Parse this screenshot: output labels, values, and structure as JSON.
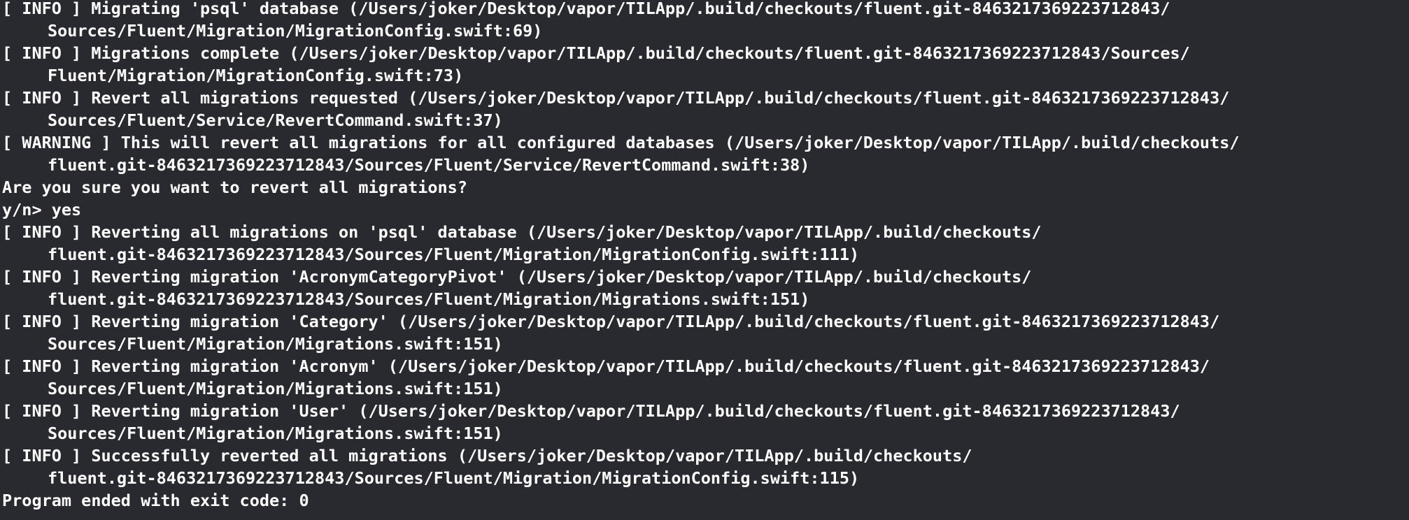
{
  "console": {
    "lines": [
      {
        "text": "[ INFO ] Migrating 'psql' database (/Users/joker/Desktop/vapor/TILApp/.build/checkouts/fluent.git-8463217369223712843/",
        "indent": false
      },
      {
        "text": "Sources/Fluent/Migration/MigrationConfig.swift:69)",
        "indent": true
      },
      {
        "text": "[ INFO ] Migrations complete (/Users/joker/Desktop/vapor/TILApp/.build/checkouts/fluent.git-8463217369223712843/Sources/",
        "indent": false
      },
      {
        "text": "Fluent/Migration/MigrationConfig.swift:73)",
        "indent": true
      },
      {
        "text": "[ INFO ] Revert all migrations requested (/Users/joker/Desktop/vapor/TILApp/.build/checkouts/fluent.git-8463217369223712843/",
        "indent": false
      },
      {
        "text": "Sources/Fluent/Service/RevertCommand.swift:37)",
        "indent": true
      },
      {
        "text": "[ WARNING ] This will revert all migrations for all configured databases (/Users/joker/Desktop/vapor/TILApp/.build/checkouts/",
        "indent": false
      },
      {
        "text": "fluent.git-8463217369223712843/Sources/Fluent/Service/RevertCommand.swift:38)",
        "indent": true
      },
      {
        "text": "Are you sure you want to revert all migrations?",
        "indent": false
      },
      {
        "text": "y/n> yes",
        "indent": false
      },
      {
        "text": "[ INFO ] Reverting all migrations on 'psql' database (/Users/joker/Desktop/vapor/TILApp/.build/checkouts/",
        "indent": false
      },
      {
        "text": "fluent.git-8463217369223712843/Sources/Fluent/Migration/MigrationConfig.swift:111)",
        "indent": true
      },
      {
        "text": "[ INFO ] Reverting migration 'AcronymCategoryPivot' (/Users/joker/Desktop/vapor/TILApp/.build/checkouts/",
        "indent": false
      },
      {
        "text": "fluent.git-8463217369223712843/Sources/Fluent/Migration/Migrations.swift:151)",
        "indent": true
      },
      {
        "text": "[ INFO ] Reverting migration 'Category' (/Users/joker/Desktop/vapor/TILApp/.build/checkouts/fluent.git-8463217369223712843/",
        "indent": false
      },
      {
        "text": "Sources/Fluent/Migration/Migrations.swift:151)",
        "indent": true
      },
      {
        "text": "[ INFO ] Reverting migration 'Acronym' (/Users/joker/Desktop/vapor/TILApp/.build/checkouts/fluent.git-8463217369223712843/",
        "indent": false
      },
      {
        "text": "Sources/Fluent/Migration/Migrations.swift:151)",
        "indent": true
      },
      {
        "text": "[ INFO ] Reverting migration 'User' (/Users/joker/Desktop/vapor/TILApp/.build/checkouts/fluent.git-8463217369223712843/",
        "indent": false
      },
      {
        "text": "Sources/Fluent/Migration/Migrations.swift:151)",
        "indent": true
      },
      {
        "text": "[ INFO ] Successfully reverted all migrations (/Users/joker/Desktop/vapor/TILApp/.build/checkouts/",
        "indent": false
      },
      {
        "text": "fluent.git-8463217369223712843/Sources/Fluent/Migration/MigrationConfig.swift:115)",
        "indent": true
      },
      {
        "text": "Program ended with exit code: 0",
        "indent": false
      }
    ]
  }
}
